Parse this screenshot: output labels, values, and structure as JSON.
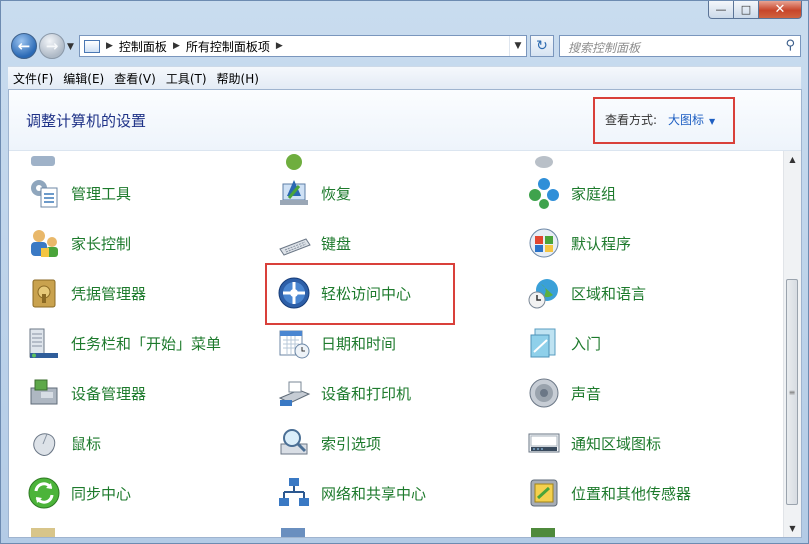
{
  "breadcrumbs": [
    "控制面板",
    "所有控制面板项"
  ],
  "search": {
    "placeholder": "搜索控制面板"
  },
  "menu": [
    "文件(F)",
    "编辑(E)",
    "查看(V)",
    "工具(T)",
    "帮助(H)"
  ],
  "header": {
    "title": "调整计算机的设置",
    "view_by_label": "查看方式:",
    "view_by_value": "大图标"
  },
  "items": [
    {
      "label": "管理工具",
      "icon": "admin-tools-icon"
    },
    {
      "label": "恢复",
      "icon": "recovery-icon"
    },
    {
      "label": "家庭组",
      "icon": "homegroup-icon"
    },
    {
      "label": "家长控制",
      "icon": "parental-controls-icon"
    },
    {
      "label": "键盘",
      "icon": "keyboard-icon"
    },
    {
      "label": "默认程序",
      "icon": "default-programs-icon"
    },
    {
      "label": "凭据管理器",
      "icon": "credential-manager-icon"
    },
    {
      "label": "轻松访问中心",
      "icon": "ease-of-access-icon"
    },
    {
      "label": "区域和语言",
      "icon": "region-language-icon"
    },
    {
      "label": "任务栏和「开始」菜单",
      "icon": "taskbar-icon"
    },
    {
      "label": "日期和时间",
      "icon": "calendar-clock-icon"
    },
    {
      "label": "入门",
      "icon": "getting-started-icon"
    },
    {
      "label": "设备管理器",
      "icon": "device-manager-icon"
    },
    {
      "label": "设备和打印机",
      "icon": "printer-icon"
    },
    {
      "label": "声音",
      "icon": "speaker-icon"
    },
    {
      "label": "鼠标",
      "icon": "mouse-icon"
    },
    {
      "label": "索引选项",
      "icon": "indexing-icon"
    },
    {
      "label": "通知区域图标",
      "icon": "notification-area-icon"
    },
    {
      "label": "同步中心",
      "icon": "sync-center-icon"
    },
    {
      "label": "网络和共享中心",
      "icon": "network-icon"
    },
    {
      "label": "位置和其他传感器",
      "icon": "location-sensors-icon"
    }
  ],
  "colors": {
    "link_green": "#1d7a2c",
    "title_blue": "#1e3287",
    "highlight_red": "#d9403a"
  }
}
